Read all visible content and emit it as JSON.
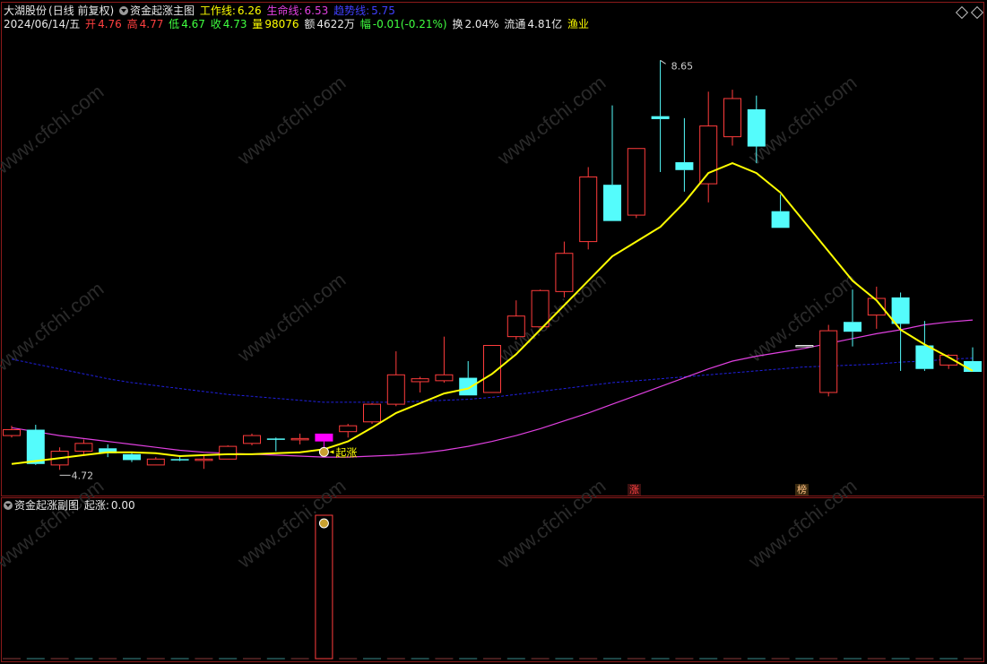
{
  "header": {
    "stock_name": "大湖股份",
    "period_mode": "(日线 前复权)",
    "indicator_name": "资金起涨主图",
    "work_line_label": "工作线:",
    "work_line_value": "6.26",
    "life_line_label": "生命线:",
    "life_line_value": "6.53",
    "trend_line_label": "趋势线:",
    "trend_line_value": "5.75",
    "date": "2024/06/14/五",
    "open_label": "开",
    "open_value": "4.76",
    "high_label": "高",
    "high_value": "4.77",
    "low_label": "低",
    "low_value": "4.67",
    "close_label": "收",
    "close_value": "4.73",
    "volume_label": "量",
    "volume_value": "98076",
    "amount_label": "额",
    "amount_value": "4622万",
    "change_label": "幅",
    "change_value": "-0.01(-0.21%)",
    "turnover_label": "换",
    "turnover_value": "2.04%",
    "float_label": "流通",
    "float_value": "4.81亿",
    "sector": "渔业"
  },
  "sub_header": {
    "indicator_name": "资金起涨副图",
    "signal_label": "起涨:",
    "signal_value": "0.00"
  },
  "annotations": {
    "high_mark": "8.65",
    "low_mark": "4.72",
    "signal_text": "起涨",
    "tag_zhang": "涨",
    "tag_bang": "榜"
  },
  "watermark": "www.cfchi.com",
  "colors": {
    "up": "#ff3c3c",
    "down": "#54fcfc",
    "signal": "#ff00ff",
    "work_line": "#ffff00",
    "life_line": "#e040e0",
    "trend_line": "#2020e0",
    "frame": "#8b1a1a"
  },
  "chart_data": {
    "type": "candlestick",
    "y_range": [
      4.4,
      8.9
    ],
    "candles": [
      {
        "o": 4.82,
        "h": 4.92,
        "l": 4.8,
        "c": 4.88
      },
      {
        "o": 4.88,
        "h": 4.93,
        "l": 4.52,
        "c": 4.53
      },
      {
        "o": 4.52,
        "h": 4.7,
        "l": 4.47,
        "c": 4.66
      },
      {
        "o": 4.66,
        "h": 4.78,
        "l": 4.62,
        "c": 4.74
      },
      {
        "o": 4.69,
        "h": 4.73,
        "l": 4.6,
        "c": 4.64
      },
      {
        "o": 4.63,
        "h": 4.65,
        "l": 4.55,
        "c": 4.57
      },
      {
        "o": 4.52,
        "h": 4.6,
        "l": 4.52,
        "c": 4.58
      },
      {
        "o": 4.58,
        "h": 4.6,
        "l": 4.56,
        "c": 4.57
      },
      {
        "o": 4.58,
        "h": 4.63,
        "l": 4.48,
        "c": 4.58
      },
      {
        "o": 4.58,
        "h": 4.72,
        "l": 4.58,
        "c": 4.71
      },
      {
        "o": 4.74,
        "h": 4.84,
        "l": 4.72,
        "c": 4.82
      },
      {
        "o": 4.79,
        "h": 4.8,
        "l": 4.66,
        "c": 4.78
      },
      {
        "o": 4.79,
        "h": 4.84,
        "l": 4.73,
        "c": 4.79
      },
      {
        "o": 4.76,
        "h": 4.84,
        "l": 4.66,
        "c": 4.84,
        "signal": true
      },
      {
        "o": 4.86,
        "h": 4.94,
        "l": 4.8,
        "c": 4.92
      },
      {
        "o": 4.96,
        "h": 5.15,
        "l": 4.94,
        "c": 5.14
      },
      {
        "o": 5.14,
        "h": 5.68,
        "l": 5.12,
        "c": 5.44
      },
      {
        "o": 5.37,
        "h": 5.42,
        "l": 5.26,
        "c": 5.4
      },
      {
        "o": 5.38,
        "h": 5.83,
        "l": 5.36,
        "c": 5.44
      },
      {
        "o": 5.41,
        "h": 5.58,
        "l": 5.23,
        "c": 5.23
      },
      {
        "o": 5.26,
        "h": 5.74,
        "l": 5.26,
        "c": 5.74
      },
      {
        "o": 5.83,
        "h": 6.2,
        "l": 5.8,
        "c": 6.04
      },
      {
        "o": 5.93,
        "h": 6.31,
        "l": 5.93,
        "c": 6.3
      },
      {
        "o": 6.29,
        "h": 6.8,
        "l": 6.23,
        "c": 6.68
      },
      {
        "o": 6.8,
        "h": 7.56,
        "l": 6.72,
        "c": 7.46
      },
      {
        "o": 7.38,
        "h": 8.19,
        "l": 7.01,
        "c": 7.01
      },
      {
        "o": 7.07,
        "h": 7.75,
        "l": 7.04,
        "c": 7.75
      },
      {
        "o": 8.08,
        "h": 8.65,
        "l": 7.51,
        "c": 8.05
      },
      {
        "o": 7.61,
        "h": 8.06,
        "l": 7.31,
        "c": 7.53
      },
      {
        "o": 7.39,
        "h": 8.33,
        "l": 7.2,
        "c": 7.98
      },
      {
        "o": 7.87,
        "h": 8.35,
        "l": 7.78,
        "c": 8.26
      },
      {
        "o": 8.15,
        "h": 8.29,
        "l": 7.6,
        "c": 7.77
      },
      {
        "o": 7.11,
        "h": 7.28,
        "l": 6.94,
        "c": 6.94
      },
      {
        "o": 5.74,
        "h": 5.74,
        "l": 5.74,
        "c": 5.74
      },
      {
        "o": 5.26,
        "h": 5.95,
        "l": 5.22,
        "c": 5.89
      },
      {
        "o": 5.98,
        "h": 6.31,
        "l": 5.73,
        "c": 5.88
      },
      {
        "o": 6.05,
        "h": 6.34,
        "l": 5.91,
        "c": 6.22
      },
      {
        "o": 6.23,
        "h": 6.28,
        "l": 5.48,
        "c": 5.96
      },
      {
        "o": 5.74,
        "h": 5.99,
        "l": 5.48,
        "c": 5.5
      },
      {
        "o": 5.54,
        "h": 5.65,
        "l": 5.5,
        "c": 5.64
      },
      {
        "o": 5.58,
        "h": 5.72,
        "l": 5.47,
        "c": 5.47
      }
    ],
    "work_line": [
      4.53,
      4.56,
      4.59,
      4.62,
      4.65,
      4.65,
      4.64,
      4.61,
      4.62,
      4.63,
      4.63,
      4.64,
      4.65,
      4.68,
      4.76,
      4.9,
      5.05,
      5.15,
      5.25,
      5.3,
      5.45,
      5.65,
      5.9,
      6.15,
      6.4,
      6.65,
      6.8,
      6.95,
      7.2,
      7.5,
      7.6,
      7.5,
      7.3,
      7.0,
      6.7,
      6.4,
      6.2,
      5.9,
      5.75,
      5.62,
      5.48
    ],
    "life_line": [
      4.9,
      4.86,
      4.82,
      4.79,
      4.76,
      4.73,
      4.7,
      4.67,
      4.65,
      4.64,
      4.63,
      4.62,
      4.61,
      4.6,
      4.6,
      4.61,
      4.62,
      4.64,
      4.67,
      4.71,
      4.76,
      4.82,
      4.89,
      4.97,
      5.05,
      5.14,
      5.23,
      5.32,
      5.41,
      5.5,
      5.58,
      5.63,
      5.67,
      5.71,
      5.76,
      5.81,
      5.86,
      5.9,
      5.95,
      5.98,
      6.0
    ],
    "trend_line": [
      5.6,
      5.55,
      5.5,
      5.45,
      5.4,
      5.36,
      5.33,
      5.3,
      5.27,
      5.24,
      5.22,
      5.2,
      5.18,
      5.16,
      5.16,
      5.16,
      5.16,
      5.17,
      5.18,
      5.19,
      5.21,
      5.24,
      5.27,
      5.3,
      5.33,
      5.36,
      5.38,
      5.4,
      5.42,
      5.44,
      5.46,
      5.48,
      5.5,
      5.52,
      5.53,
      5.54,
      5.55,
      5.57,
      5.58,
      5.6,
      5.61
    ],
    "sub_signal": [
      0,
      0,
      0,
      0,
      0,
      0,
      0,
      0,
      0,
      0,
      0,
      0,
      0,
      1,
      0,
      0,
      0,
      0,
      0,
      0,
      0,
      0,
      0,
      0,
      0,
      0,
      0,
      0,
      0,
      0,
      0,
      0,
      0,
      0,
      0,
      0,
      0,
      0,
      0,
      0,
      0
    ]
  }
}
